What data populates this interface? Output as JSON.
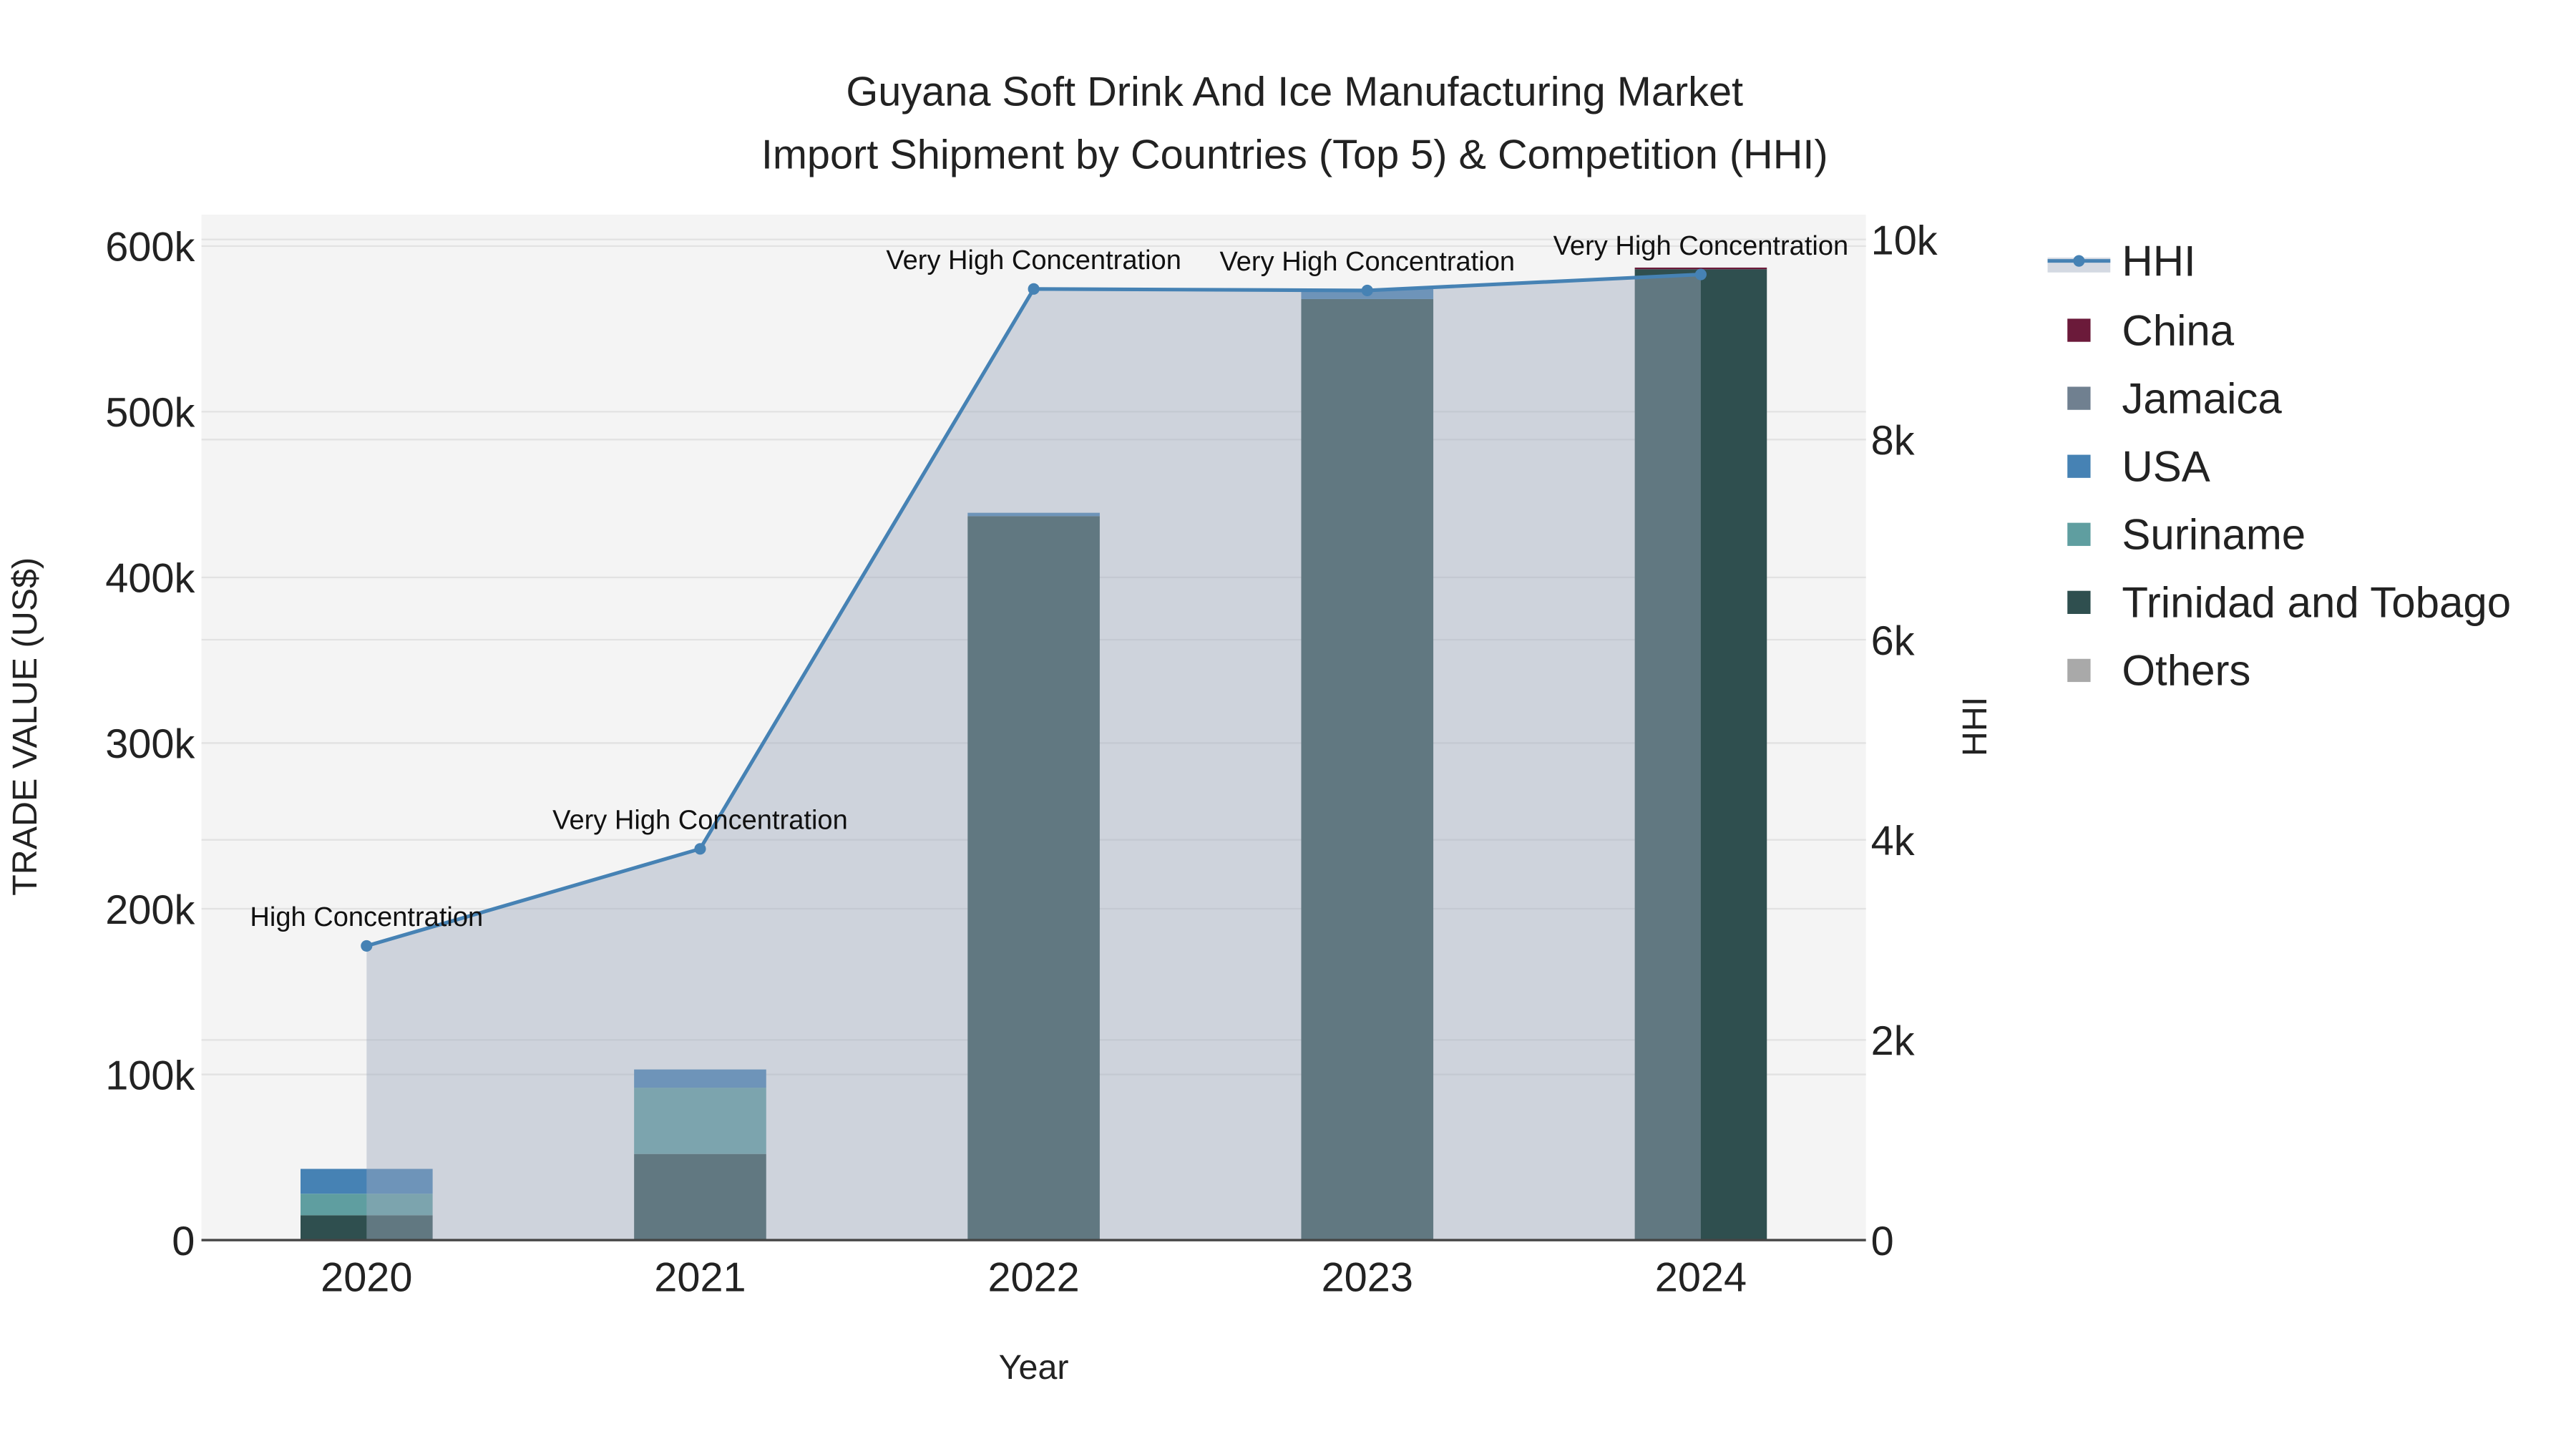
{
  "chart_data": {
    "type": "bar",
    "title_line1": "Guyana Soft Drink And Ice Manufacturing Market",
    "title_line2": "Import Shipment by Countries (Top 5) & Competition (HHI)",
    "xlabel": "Year",
    "ylabel": "TRADE VALUE (US$)",
    "y2label": "HHI",
    "categories": [
      "2020",
      "2021",
      "2022",
      "2023",
      "2024"
    ],
    "ylim": [
      0,
      620000
    ],
    "y2lim": [
      0,
      10250
    ],
    "yticks": [
      0,
      100000,
      200000,
      300000,
      400000,
      500000,
      600000
    ],
    "ytick_labels": [
      "0",
      "100k",
      "200k",
      "300k",
      "400k",
      "500k",
      "600k"
    ],
    "y2ticks": [
      0,
      2000,
      4000,
      6000,
      8000,
      10000
    ],
    "y2tick_labels": [
      "0",
      "2k",
      "4k",
      "6k",
      "8k",
      "10k"
    ],
    "series": [
      {
        "name": "Trinidad and Tobago",
        "color": "#2f4f4f",
        "values": [
          15000,
          52000,
          437000,
          568000,
          586000
        ]
      },
      {
        "name": "Suriname",
        "color": "#5f9ea0",
        "values": [
          13000,
          40000,
          0,
          0,
          0
        ]
      },
      {
        "name": "USA",
        "color": "#4682b4",
        "values": [
          15000,
          11000,
          2000,
          6000,
          0
        ]
      },
      {
        "name": "Jamaica",
        "color": "#708090",
        "values": [
          0,
          0,
          0,
          0,
          0
        ]
      },
      {
        "name": "China",
        "color": "#6b1a3a",
        "values": [
          0,
          0,
          0,
          0,
          1000
        ]
      },
      {
        "name": "Others",
        "color": "#a9a9a9",
        "values": [
          0,
          0,
          0,
          0,
          0
        ]
      }
    ],
    "hhi": {
      "name": "HHI",
      "color": "#4682b4",
      "values": [
        2940,
        3910,
        9505,
        9490,
        9650
      ],
      "labels": [
        "High Concentration",
        "Very High Concentration",
        "Very High Concentration",
        "Very High Concentration",
        "Very High Concentration"
      ]
    },
    "legend_order": [
      "HHI",
      "China",
      "Jamaica",
      "USA",
      "Suriname",
      "Trinidad and Tobago",
      "Others"
    ],
    "legend_placement": "right",
    "grid": true
  }
}
